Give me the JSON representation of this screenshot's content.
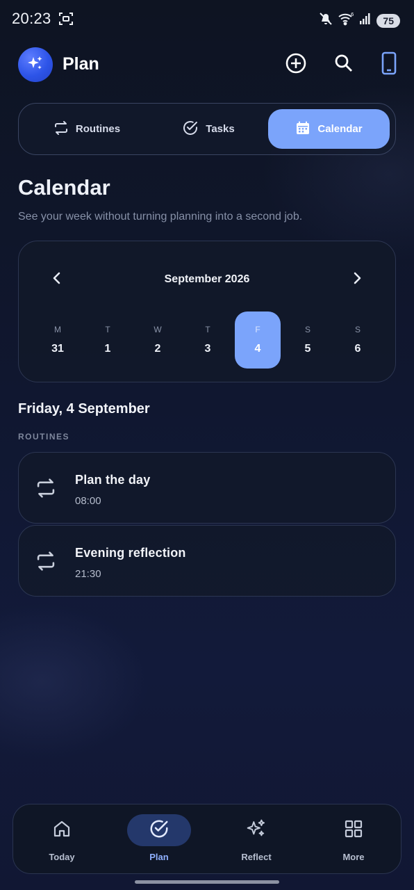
{
  "status_bar": {
    "time": "20:23",
    "battery": "75",
    "icons": [
      "screenshot-icon",
      "mute-icon",
      "wifi-icon",
      "signal-icon"
    ]
  },
  "app_bar": {
    "title": "Plan",
    "logo_icon": "sparkles-icon",
    "actions": [
      "add-circle-icon",
      "search-icon",
      "phone-icon"
    ]
  },
  "tabs": [
    {
      "label": "Routines",
      "icon": "repeat-icon",
      "active": false
    },
    {
      "label": "Tasks",
      "icon": "check-circle-icon",
      "active": false
    },
    {
      "label": "Calendar",
      "icon": "calendar-icon",
      "active": true
    }
  ],
  "page": {
    "title": "Calendar",
    "subtitle": "See your week without turning planning into a second job."
  },
  "calendar": {
    "month": "September 2026",
    "days": [
      {
        "letter": "M",
        "number": "31",
        "selected": false
      },
      {
        "letter": "T",
        "number": "1",
        "selected": false
      },
      {
        "letter": "W",
        "number": "2",
        "selected": false
      },
      {
        "letter": "T",
        "number": "3",
        "selected": false
      },
      {
        "letter": "F",
        "number": "4",
        "selected": true
      },
      {
        "letter": "S",
        "number": "5",
        "selected": false
      },
      {
        "letter": "S",
        "number": "6",
        "selected": false
      }
    ]
  },
  "selected_date": "Friday, 4 September",
  "routines_section": {
    "label": "ROUTINES",
    "items": [
      {
        "title": "Plan the day",
        "time": "08:00"
      },
      {
        "title": "Evening reflection",
        "time": "21:30"
      }
    ]
  },
  "bottom_nav": [
    {
      "label": "Today",
      "icon": "home-icon",
      "active": false
    },
    {
      "label": "Plan",
      "icon": "check-circle-icon",
      "active": true
    },
    {
      "label": "Reflect",
      "icon": "sparkles-icon",
      "active": false
    },
    {
      "label": "More",
      "icon": "grid-icon",
      "active": false
    }
  ],
  "colors": {
    "accent": "#7ba4fb",
    "nav_active_pill": "#24386b",
    "background": "#111733"
  }
}
